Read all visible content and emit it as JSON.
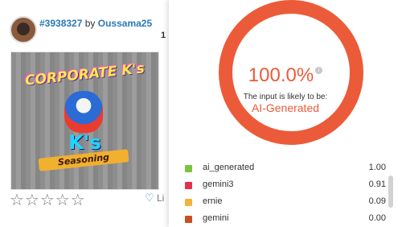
{
  "listing": {
    "id": "#3938327",
    "by": "by",
    "author": "Oussama25",
    "rank": "1",
    "artwork": {
      "title": "CORPORATE K's",
      "sub": "K's",
      "banner": "Seasoning"
    },
    "stars": "☆☆☆☆☆",
    "like": "Li"
  },
  "detector": {
    "score": "100.0%",
    "likely_label": "The input is likely to be:",
    "verdict": "AI-Generated",
    "accent": "#ec5b39",
    "models": [
      {
        "name": "ai_generated",
        "value": "1.00",
        "color": "#7cc242"
      },
      {
        "name": "gemini3",
        "value": "0.91",
        "color": "#e3324d"
      },
      {
        "name": "ernie",
        "value": "0.09",
        "color": "#f4b23a"
      },
      {
        "name": "gemini",
        "value": "0.00",
        "color": "#c8501c"
      }
    ]
  }
}
